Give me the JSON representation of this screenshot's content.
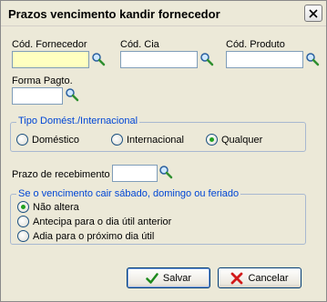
{
  "window": {
    "title": "Prazos vencimento kandir fornecedor"
  },
  "fields": {
    "cod_fornecedor": {
      "label": "Cód. Fornecedor",
      "value": ""
    },
    "cod_cia": {
      "label": "Cód. Cia",
      "value": ""
    },
    "cod_produto": {
      "label": "Cód. Produto",
      "value": ""
    },
    "forma_pagto": {
      "label": "Forma Pagto.",
      "value": ""
    },
    "prazo_recebimento": {
      "label": "Prazo de recebimento",
      "value": ""
    }
  },
  "tipo_group": {
    "legend": "Tipo Domést./Internacional",
    "options": [
      "Doméstico",
      "Internacional",
      "Qualquer"
    ],
    "selected": "Qualquer"
  },
  "vencimento_group": {
    "legend": "Se o vencimento cair sábado, domingo ou feriado",
    "options": [
      "Não altera",
      "Antecipa para o dia útil anterior",
      "Adia para o próximo dia útil"
    ],
    "selected": "Não altera"
  },
  "buttons": {
    "salvar": "Salvar",
    "cancelar": "Cancelar"
  },
  "icons": {
    "search": "search-icon",
    "save": "check-icon",
    "cancel": "x-icon",
    "close": "close-icon"
  },
  "colors": {
    "legend_text": "#0046d5",
    "required_field": "#ffffc0",
    "radio_selected": "#21a121"
  }
}
